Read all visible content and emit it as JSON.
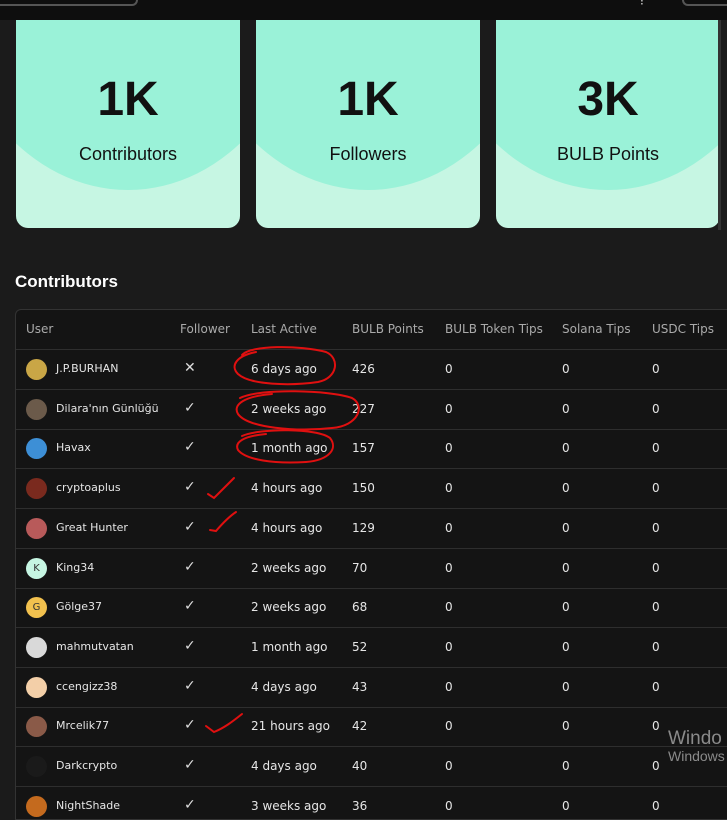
{
  "stats": [
    {
      "value": "1K",
      "label": "Contributors"
    },
    {
      "value": "1K",
      "label": "Followers"
    },
    {
      "value": "3K",
      "label": "BULB Points"
    }
  ],
  "section_title": "Contributors",
  "table": {
    "headers": [
      "User",
      "Follower",
      "Last Active",
      "BULB Points",
      "BULB Token Tips",
      "Solana Tips",
      "USDC Tips"
    ],
    "rows": [
      {
        "user": "J.P.BURHAN",
        "follower": "✕",
        "last_active": "6 days ago",
        "points": "426",
        "bulb_tips": "0",
        "solana_tips": "0",
        "usdc_tips": "0",
        "avatar_color": "#c9a646"
      },
      {
        "user": "Dilara'nın Günlüğü",
        "follower": "✓",
        "last_active": "2 weeks ago",
        "points": "227",
        "bulb_tips": "0",
        "solana_tips": "0",
        "usdc_tips": "0",
        "avatar_color": "#6b5a4a"
      },
      {
        "user": "Havax",
        "follower": "✓",
        "last_active": "1 month ago",
        "points": "157",
        "bulb_tips": "0",
        "solana_tips": "0",
        "usdc_tips": "0",
        "avatar_color": "#3d8fd6"
      },
      {
        "user": "cryptoaplus",
        "follower": "✓",
        "last_active": "4 hours ago",
        "points": "150",
        "bulb_tips": "0",
        "solana_tips": "0",
        "usdc_tips": "0",
        "avatar_color": "#7a2a1e"
      },
      {
        "user": "Great Hunter",
        "follower": "✓",
        "last_active": "4 hours ago",
        "points": "129",
        "bulb_tips": "0",
        "solana_tips": "0",
        "usdc_tips": "0",
        "avatar_color": "#b85a5a"
      },
      {
        "user": "King34",
        "follower": "✓",
        "last_active": "2 weeks ago",
        "points": "70",
        "bulb_tips": "0",
        "solana_tips": "0",
        "usdc_tips": "0",
        "avatar_color": "#c6f6e3",
        "avatar_letter": "K"
      },
      {
        "user": "Gölge37",
        "follower": "✓",
        "last_active": "2 weeks ago",
        "points": "68",
        "bulb_tips": "0",
        "solana_tips": "0",
        "usdc_tips": "0",
        "avatar_color": "#f2c14e",
        "avatar_letter": "G"
      },
      {
        "user": "mahmutvatan",
        "follower": "✓",
        "last_active": "1 month ago",
        "points": "52",
        "bulb_tips": "0",
        "solana_tips": "0",
        "usdc_tips": "0",
        "avatar_color": "#d9d9d9"
      },
      {
        "user": "ccengizz38",
        "follower": "✓",
        "last_active": "4 days ago",
        "points": "43",
        "bulb_tips": "0",
        "solana_tips": "0",
        "usdc_tips": "0",
        "avatar_color": "#f3cfa8"
      },
      {
        "user": "Mrcelik77",
        "follower": "✓",
        "last_active": "21 hours ago",
        "points": "42",
        "bulb_tips": "0",
        "solana_tips": "0",
        "usdc_tips": "0",
        "avatar_color": "#8a5a48"
      },
      {
        "user": "Darkcrypto",
        "follower": "✓",
        "last_active": "4 days ago",
        "points": "40",
        "bulb_tips": "0",
        "solana_tips": "0",
        "usdc_tips": "0",
        "avatar_color": "#1a1a1a"
      },
      {
        "user": "NightShade",
        "follower": "✓",
        "last_active": "3 weeks ago",
        "points": "36",
        "bulb_tips": "0",
        "solana_tips": "0",
        "usdc_tips": "0",
        "avatar_color": "#c46a1e"
      }
    ]
  },
  "watermark": {
    "line1": "Windo",
    "line2": "Windows"
  },
  "colors": {
    "card": "#c6f6e3",
    "card_blob": "#9af2d8",
    "annotation": "#e01010",
    "background": "#1b1b1b"
  }
}
